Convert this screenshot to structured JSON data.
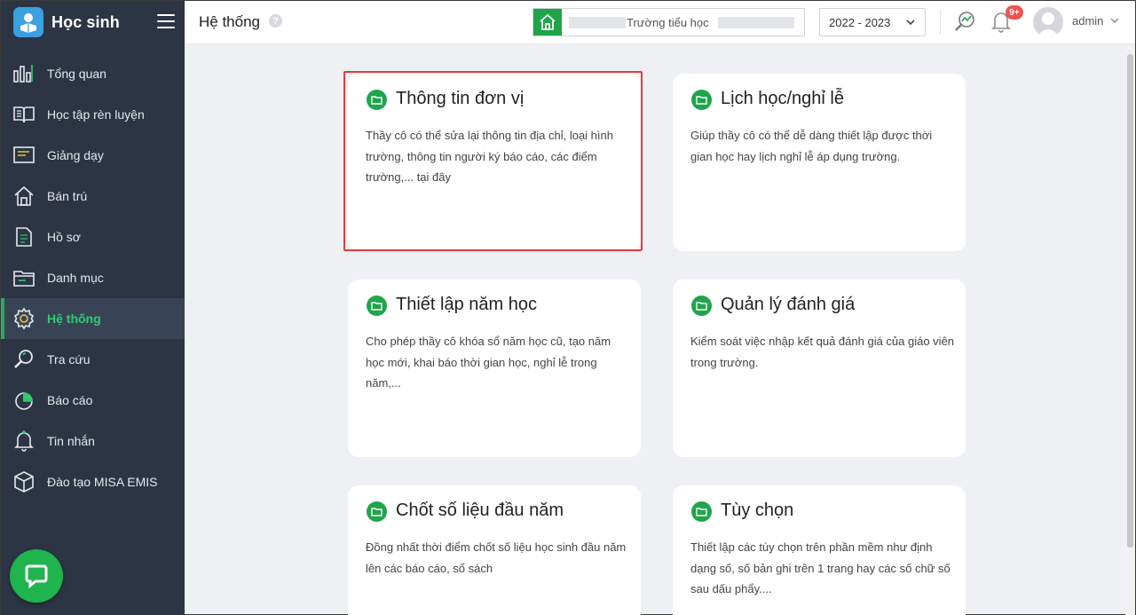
{
  "brand": {
    "title": "Học sinh"
  },
  "sidebar": {
    "items": [
      {
        "label": "Tổng quan",
        "icon": "chart-bars-icon"
      },
      {
        "label": "Học tập rèn luyện",
        "icon": "book-open-icon"
      },
      {
        "label": "Giảng dạy",
        "icon": "board-icon"
      },
      {
        "label": "Bán trú",
        "icon": "home-icon"
      },
      {
        "label": "Hồ sơ",
        "icon": "document-icon"
      },
      {
        "label": "Danh mục",
        "icon": "folder-icon"
      },
      {
        "label": "Hệ thống",
        "icon": "gear-icon",
        "active": true
      },
      {
        "label": "Tra cứu",
        "icon": "search-icon"
      },
      {
        "label": "Báo cáo",
        "icon": "pie-chart-icon"
      },
      {
        "label": "Tin nhắn",
        "icon": "bell-icon"
      },
      {
        "label": "Đào tạo MISA EMIS",
        "icon": "box-icon"
      }
    ]
  },
  "header": {
    "title": "Hệ thống",
    "help": "?",
    "school_name": "Trường tiểu học",
    "year": "2022 - 2023",
    "notification_badge": "9+",
    "username": "admin"
  },
  "cards": [
    {
      "title": "Thông tin đơn vị",
      "description": "Thầy cô có thể sửa lại thông tin địa chỉ, loại hình trường, thông tin người ký báo cáo, các điểm trường,... tại đây",
      "highlighted": true
    },
    {
      "title": "Lịch học/nghỉ lễ",
      "description": "Giúp thầy cô có thể dễ dàng thiết lập được thời gian học hay lịch nghỉ lễ áp dụng trường."
    },
    {
      "title": "Thiết lập năm học",
      "description": "Cho phép thầy cô khóa sổ năm học cũ, tạo năm học mới, khai báo thời gian học, nghỉ lễ trong năm,..."
    },
    {
      "title": "Quản lý đánh giá",
      "description": "Kiểm soát việc nhập kết quả đánh giá của giáo viên trong trường."
    },
    {
      "title": "Chốt số liệu đầu năm",
      "description": "Đồng nhất thời điểm chốt số liệu học sinh đầu năm lên các báo cáo, sổ sách"
    },
    {
      "title": "Tùy chọn",
      "description": "Thiết lập các tùy chọn trên phần mềm như định dạng số, số bản ghi trên 1 trang hay các số chữ số sau dấu phẩy...."
    }
  ],
  "colors": {
    "sidebar_bg": "#2b3544",
    "accent_green": "#1fa54a",
    "highlight_red": "#e23b3b",
    "badge_red": "#f0524f"
  }
}
